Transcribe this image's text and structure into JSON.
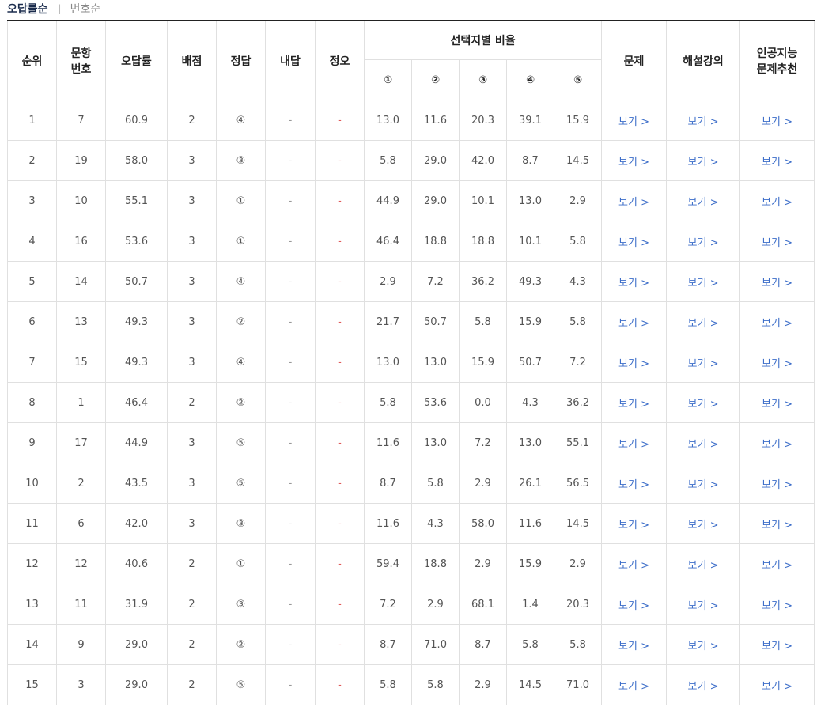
{
  "tabs": {
    "active": "오답률순",
    "separator": "|",
    "inactive": "번호순"
  },
  "headers": {
    "rank": "순위",
    "qnum_line1": "문항",
    "qnum_line2": "번호",
    "error_rate": "오답률",
    "score": "배점",
    "answer": "정답",
    "my_answer": "내답",
    "correct": "정오",
    "choice_ratio": "선택지별 비율",
    "choices": [
      "①",
      "②",
      "③",
      "④",
      "⑤"
    ],
    "problem": "문제",
    "lecture": "해설강의",
    "ai_line1": "인공지능",
    "ai_line2": "문제추천"
  },
  "rows": [
    {
      "rank": "1",
      "num": "7",
      "rate": "60.9",
      "score": "2",
      "answer": "④",
      "mine": "-",
      "ox": "-",
      "c": [
        "13.0",
        "11.6",
        "20.3",
        "39.1",
        "15.9"
      ],
      "view1": "보기 >",
      "view2": "보기 >",
      "view3": "보기 >"
    },
    {
      "rank": "2",
      "num": "19",
      "rate": "58.0",
      "score": "3",
      "answer": "③",
      "mine": "-",
      "ox": "-",
      "c": [
        "5.8",
        "29.0",
        "42.0",
        "8.7",
        "14.5"
      ],
      "view1": "보기 >",
      "view2": "보기 >",
      "view3": "보기 >"
    },
    {
      "rank": "3",
      "num": "10",
      "rate": "55.1",
      "score": "3",
      "answer": "①",
      "mine": "-",
      "ox": "-",
      "c": [
        "44.9",
        "29.0",
        "10.1",
        "13.0",
        "2.9"
      ],
      "view1": "보기 >",
      "view2": "보기 >",
      "view3": "보기 >"
    },
    {
      "rank": "4",
      "num": "16",
      "rate": "53.6",
      "score": "3",
      "answer": "①",
      "mine": "-",
      "ox": "-",
      "c": [
        "46.4",
        "18.8",
        "18.8",
        "10.1",
        "5.8"
      ],
      "view1": "보기 >",
      "view2": "보기 >",
      "view3": "보기 >"
    },
    {
      "rank": "5",
      "num": "14",
      "rate": "50.7",
      "score": "3",
      "answer": "④",
      "mine": "-",
      "ox": "-",
      "c": [
        "2.9",
        "7.2",
        "36.2",
        "49.3",
        "4.3"
      ],
      "view1": "보기 >",
      "view2": "보기 >",
      "view3": "보기 >"
    },
    {
      "rank": "6",
      "num": "13",
      "rate": "49.3",
      "score": "3",
      "answer": "②",
      "mine": "-",
      "ox": "-",
      "c": [
        "21.7",
        "50.7",
        "5.8",
        "15.9",
        "5.8"
      ],
      "view1": "보기 >",
      "view2": "보기 >",
      "view3": "보기 >"
    },
    {
      "rank": "7",
      "num": "15",
      "rate": "49.3",
      "score": "3",
      "answer": "④",
      "mine": "-",
      "ox": "-",
      "c": [
        "13.0",
        "13.0",
        "15.9",
        "50.7",
        "7.2"
      ],
      "view1": "보기 >",
      "view2": "보기 >",
      "view3": "보기 >"
    },
    {
      "rank": "8",
      "num": "1",
      "rate": "46.4",
      "score": "2",
      "answer": "②",
      "mine": "-",
      "ox": "-",
      "c": [
        "5.8",
        "53.6",
        "0.0",
        "4.3",
        "36.2"
      ],
      "view1": "보기 >",
      "view2": "보기 >",
      "view3": "보기 >"
    },
    {
      "rank": "9",
      "num": "17",
      "rate": "44.9",
      "score": "3",
      "answer": "⑤",
      "mine": "-",
      "ox": "-",
      "c": [
        "11.6",
        "13.0",
        "7.2",
        "13.0",
        "55.1"
      ],
      "view1": "보기 >",
      "view2": "보기 >",
      "view3": "보기 >"
    },
    {
      "rank": "10",
      "num": "2",
      "rate": "43.5",
      "score": "3",
      "answer": "⑤",
      "mine": "-",
      "ox": "-",
      "c": [
        "8.7",
        "5.8",
        "2.9",
        "26.1",
        "56.5"
      ],
      "view1": "보기 >",
      "view2": "보기 >",
      "view3": "보기 >"
    },
    {
      "rank": "11",
      "num": "6",
      "rate": "42.0",
      "score": "3",
      "answer": "③",
      "mine": "-",
      "ox": "-",
      "c": [
        "11.6",
        "4.3",
        "58.0",
        "11.6",
        "14.5"
      ],
      "view1": "보기 >",
      "view2": "보기 >",
      "view3": "보기 >"
    },
    {
      "rank": "12",
      "num": "12",
      "rate": "40.6",
      "score": "2",
      "answer": "①",
      "mine": "-",
      "ox": "-",
      "c": [
        "59.4",
        "18.8",
        "2.9",
        "15.9",
        "2.9"
      ],
      "view1": "보기 >",
      "view2": "보기 >",
      "view3": "보기 >"
    },
    {
      "rank": "13",
      "num": "11",
      "rate": "31.9",
      "score": "2",
      "answer": "③",
      "mine": "-",
      "ox": "-",
      "c": [
        "7.2",
        "2.9",
        "68.1",
        "1.4",
        "20.3"
      ],
      "view1": "보기 >",
      "view2": "보기 >",
      "view3": "보기 >"
    },
    {
      "rank": "14",
      "num": "9",
      "rate": "29.0",
      "score": "2",
      "answer": "②",
      "mine": "-",
      "ox": "-",
      "c": [
        "8.7",
        "71.0",
        "8.7",
        "5.8",
        "5.8"
      ],
      "view1": "보기 >",
      "view2": "보기 >",
      "view3": "보기 >"
    },
    {
      "rank": "15",
      "num": "3",
      "rate": "29.0",
      "score": "2",
      "answer": "⑤",
      "mine": "-",
      "ox": "-",
      "c": [
        "5.8",
        "5.8",
        "2.9",
        "14.5",
        "71.0"
      ],
      "view1": "보기 >",
      "view2": "보기 >",
      "view3": "보기 >"
    }
  ]
}
